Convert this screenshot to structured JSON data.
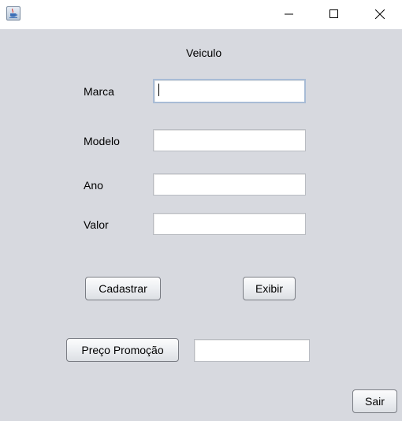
{
  "window": {
    "icon": "java-cup-icon",
    "controls": {
      "minimize": "minimize-icon",
      "maximize": "maximize-icon",
      "close": "close-icon"
    }
  },
  "form": {
    "title": "Veiculo",
    "fields": {
      "marca": {
        "label": "Marca",
        "value": ""
      },
      "modelo": {
        "label": "Modelo",
        "value": ""
      },
      "ano": {
        "label": "Ano",
        "value": ""
      },
      "valor": {
        "label": "Valor",
        "value": ""
      }
    },
    "buttons": {
      "cadastrar": "Cadastrar",
      "exibir": "Exibir",
      "preco_promocao": "Preço Promoção",
      "sair": "Sair"
    },
    "promo_value": ""
  },
  "colors": {
    "panel_background": "#d7d9df",
    "focus_border": "#a8bcd6"
  }
}
